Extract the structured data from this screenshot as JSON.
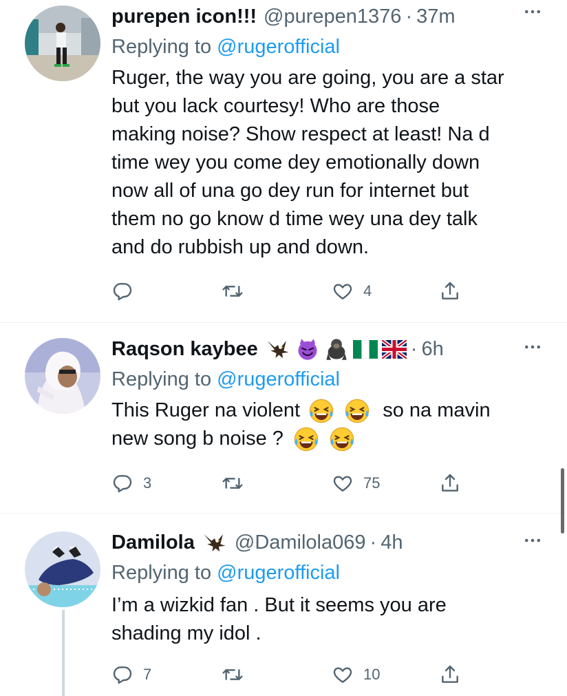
{
  "tweets": [
    {
      "name": "purepen icon!!!",
      "handle": "@purepen1376",
      "time": "37m",
      "replying_prefix": "Replying to",
      "replying_to": "@rugerofficial",
      "text_lines": [
        "Ruger, the way you are going, you are a star",
        "but you lack courtesy! Who are those",
        "making noise? Show respect at least! Na d",
        "time wey you come dey emotionally down",
        "now all of una go dey run for internet but",
        "them no go know d time wey una dey talk",
        "and do rubbish up and down."
      ],
      "replies": "",
      "retweets": "",
      "likes": "4"
    },
    {
      "name": "Raqson kaybee",
      "time": "6h",
      "replying_prefix": "Replying to",
      "replying_to": "@rugerofficial",
      "line1_a": "This Ruger na violent",
      "line1_b": "so na mavin",
      "line2_a": "new song b noise ?",
      "replies": "3",
      "retweets": "",
      "likes": "75"
    },
    {
      "name": "Damilola",
      "handle": "@Damilola069",
      "time": "4h",
      "replying_prefix": "Replying to",
      "replying_to": "@rugerofficial",
      "text_lines": [
        "I’m a wizkid fan . But it seems you are",
        "shading my idol ."
      ],
      "replies": "7",
      "retweets": "",
      "likes": "10"
    }
  ],
  "colors": {
    "text": "#0f1419",
    "secondary": "#536471",
    "link": "#1d9bf0",
    "divider": "#eff3f4"
  },
  "icons": [
    "reply-icon",
    "retweet-icon",
    "like-icon",
    "share-icon",
    "more-icon",
    "eagle-emoji",
    "devil-emoji",
    "gorilla-emoji",
    "nigeria-flag-emoji",
    "uk-flag-emoji",
    "laughing-crying-emoji"
  ]
}
